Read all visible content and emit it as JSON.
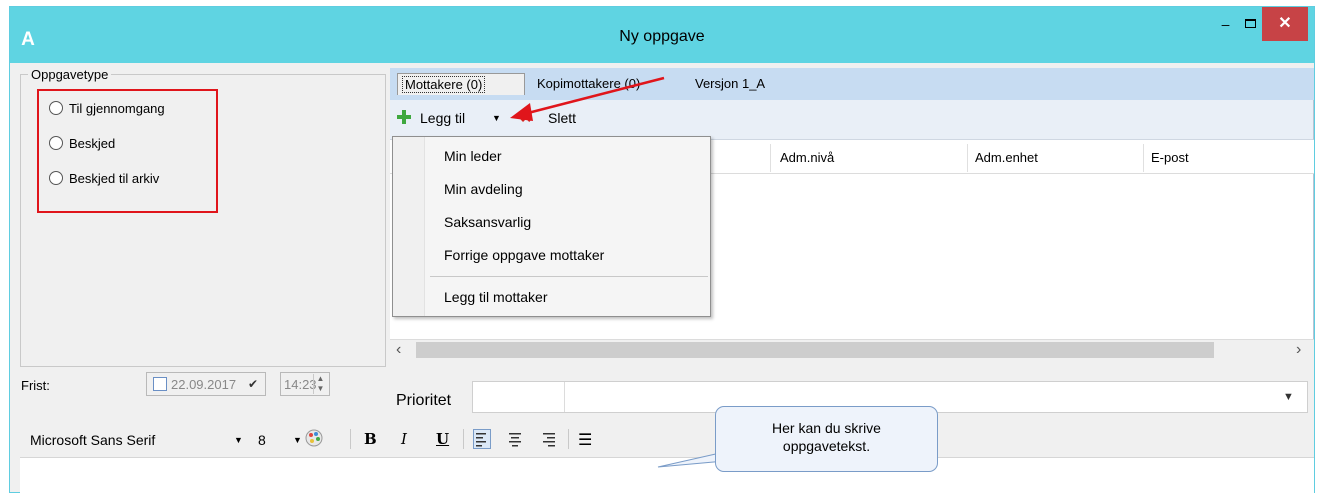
{
  "window": {
    "app_icon": "A",
    "title": "Ny oppgave",
    "min_glyph": "‒",
    "close_glyph": "✕"
  },
  "task_type": {
    "group_title": "Oppgavetype",
    "options": [
      "Til gjennomgang",
      "Beskjed",
      "Beskjed til arkiv"
    ]
  },
  "tabs": [
    "Mottakere (0)",
    "Kopimottakere (0)",
    "Versjon 1_A"
  ],
  "toolbar": {
    "add_label": "Legg til",
    "add_dropdown_glyph": "▼",
    "delete_icon_glyph": "✖",
    "delete_label": "Slett"
  },
  "columns": [
    "Adm.nivå",
    "Adm.enhet",
    "E-post"
  ],
  "menu": {
    "items": [
      "Min leder",
      "Min avdeling",
      "Saksansvarlig",
      "Forrige oppgave mottaker"
    ],
    "footer_item": "Legg til mottaker"
  },
  "scroll": {
    "left": "‹",
    "right": "›"
  },
  "deadline": {
    "label": "Frist:",
    "date": "22.09.2017",
    "date_dropdown_glyph": "✔",
    "time": "14:23",
    "spin_up": "▲",
    "spin_down": "▼"
  },
  "priority": {
    "label": "Prioritet",
    "value": "",
    "dropdown_glyph": "▼"
  },
  "format": {
    "font": "Microsoft Sans Serif",
    "size": "8",
    "dd_glyph": "▼",
    "bold": "B",
    "italic": "I",
    "underline": "U",
    "bullets_glyph": "☰"
  },
  "callout": {
    "line1": "Her kan du skrive",
    "line2": "oppgavetekst."
  },
  "colors": {
    "titlebar": "#5fd4e2",
    "close": "#c74346",
    "highlight": "#e0151b",
    "tabstrip": "#c7dcf2"
  }
}
